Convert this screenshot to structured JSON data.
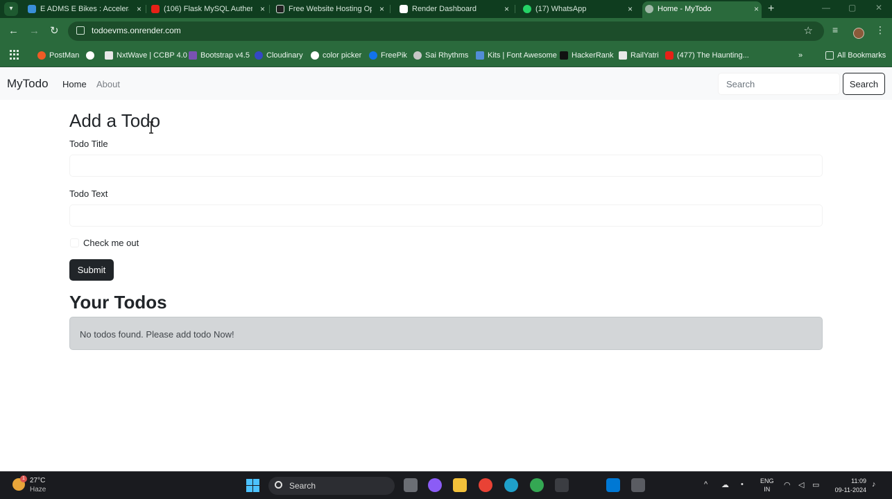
{
  "browser": {
    "tabs": [
      {
        "title": "E ADMS E Bikes : Accelerat",
        "active": false,
        "icon_color": "#3a8fd8",
        "icon": "gear-icon"
      },
      {
        "title": "(106) Flask MySQL Authen",
        "active": false,
        "icon_color": "#e62117",
        "icon": "youtube-icon"
      },
      {
        "title": "Free Website Hosting Opt",
        "active": false,
        "icon_color": "#222222",
        "icon": "openai-icon"
      },
      {
        "title": "Render Dashboard",
        "active": false,
        "icon_color": "#ffffff",
        "icon": "render-icon"
      },
      {
        "title": "(17) WhatsApp",
        "active": false,
        "icon_color": "#25d366",
        "icon": "whatsapp-icon"
      },
      {
        "title": "Home - MyTodo",
        "active": true,
        "icon_color": "#9fb8a7",
        "icon": "globe-icon"
      }
    ],
    "close_glyph": "×",
    "new_tab_glyph": "+",
    "url": "todoevms.onrender.com",
    "bookmarks": [
      {
        "label": "PostMan",
        "icon_color": "#ef5b25"
      },
      {
        "label": "",
        "icon_color": "#ffffff"
      },
      {
        "label": "NxtWave | CCBP 4.0",
        "icon_color": "#e8e8e8"
      },
      {
        "label": "Bootstrap v4.5",
        "icon_color": "#7952b3"
      },
      {
        "label": "Cloudinary",
        "icon_color": "#3448c5"
      },
      {
        "label": "color picker",
        "icon_color": "#ffffff"
      },
      {
        "label": "FreePik",
        "icon_color": "#1273eb"
      },
      {
        "label": "Sai Rhythms",
        "icon_color": "#c7c7c7"
      },
      {
        "label": "Kits | Font Awesome",
        "icon_color": "#528dd7"
      },
      {
        "label": "HackerRank",
        "icon_color": "#111111"
      },
      {
        "label": "RailYatri",
        "icon_color": "#e8e8e8"
      },
      {
        "label": "(477) The Haunting...",
        "icon_color": "#e62117"
      }
    ],
    "more_bookmarks_glyph": "»",
    "all_bookmarks": "All Bookmarks"
  },
  "navbar": {
    "brand": "MyTodo",
    "links": [
      "Home",
      "About"
    ],
    "search_placeholder": "Search",
    "search_button": "Search"
  },
  "form": {
    "heading": "Add a Todo",
    "title_label": "Todo Title",
    "title_value": "",
    "text_label": "Todo Text",
    "text_value": "",
    "checkbox_label": "Check me out",
    "checkbox_checked": false,
    "submit_label": "Submit"
  },
  "todos": {
    "heading": "Your Todos",
    "empty_message": "No todos found. Please add todo Now!"
  },
  "taskbar": {
    "weather_temp": "27°C",
    "weather_cond": "Haze",
    "weather_badge": "1",
    "search_label": "Search",
    "lang_top": "ENG",
    "lang_bottom": "IN",
    "time": "11:09",
    "date": "09-11-2024"
  }
}
